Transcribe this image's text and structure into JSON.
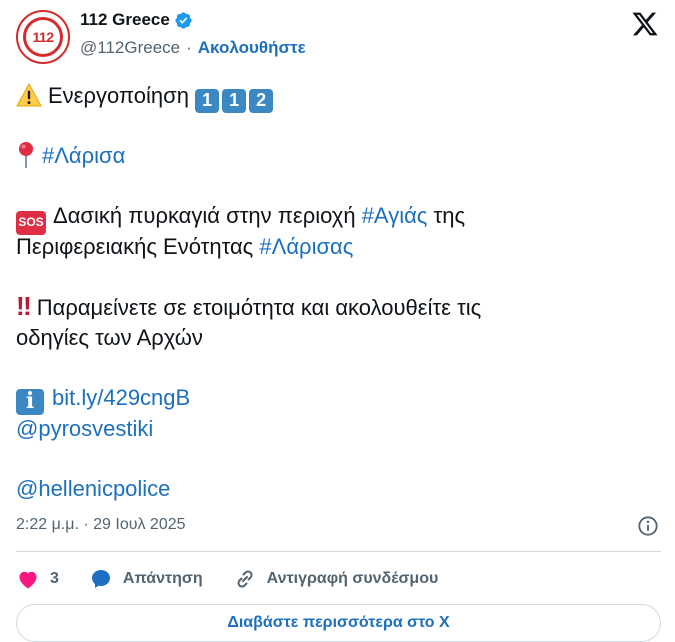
{
  "account": {
    "display_name": "112 Greece",
    "handle": "@112Greece",
    "separator": "·",
    "follow_label": "Ακολουθήστε",
    "avatar_text": "112",
    "verified": true
  },
  "tweet": {
    "line1_text": "Ενεργοποίηση",
    "line1_keycaps": [
      "1",
      "1",
      "2"
    ],
    "location_hashtag": "#Λάρισα",
    "sos_badge": "SOS",
    "fire_text_a": "Δασική πυρκαγιά στην περιοχή",
    "fire_hashtag_a": "#Αγιάς",
    "fire_text_b": "της",
    "fire_text_c": "Περιφερειακής Ενότητας",
    "fire_hashtag_b": "#Λάρισας",
    "warning_mark": "‼",
    "warning_text_a": "Παραμείνετε σε ετοιμότητα και ακολουθείτε τις",
    "warning_text_b": "οδηγίες των Αρχών",
    "info_glyph": "i",
    "link": "bit.ly/429cngB",
    "mention_1": "@pyrosvestiki",
    "mention_2": "@hellenicpolice"
  },
  "timestamp": "2:22 μ.μ. · 29 Ιουλ 2025",
  "actions": {
    "like_count": "3",
    "reply_label": "Απάντηση",
    "copy_link_label": "Αντιγραφή συνδέσμου"
  },
  "read_more_label": "Διαβάστε περισσότερα στο X",
  "colors": {
    "link": "#1d6fbf",
    "like": "#f91880",
    "verified": "#1d9bf0",
    "brand_red": "#d52b2b"
  }
}
